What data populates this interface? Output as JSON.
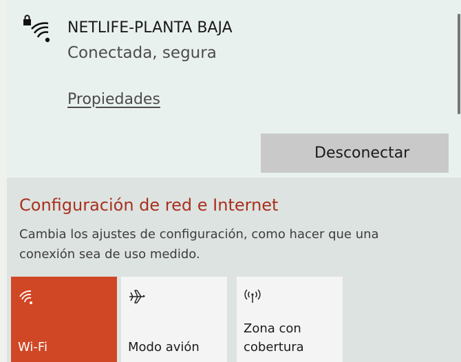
{
  "network": {
    "name": "NETLIFE-PLANTA BAJA",
    "status": "Conectada, segura",
    "properties_link": "Propiedades",
    "disconnect_label": "Desconectar"
  },
  "settings": {
    "title": "Configuración de red e Internet",
    "description": "Cambia los ajustes de configuración, como hacer que una conexión sea de uso medido."
  },
  "quick_actions": [
    {
      "label": "Wi-Fi",
      "icon": "wifi-icon",
      "active": true
    },
    {
      "label": "Modo avión",
      "icon": "airplane-icon",
      "active": false
    },
    {
      "label": "Zona con cobertura",
      "icon": "hotspot-icon",
      "active": false
    }
  ],
  "colors": {
    "accent": "#d04725",
    "title": "#a8301f",
    "panel": "#e9f1ee",
    "settings_bg": "#dde3e0",
    "button": "#c9c9c9",
    "tile": "#f3f4f3"
  }
}
